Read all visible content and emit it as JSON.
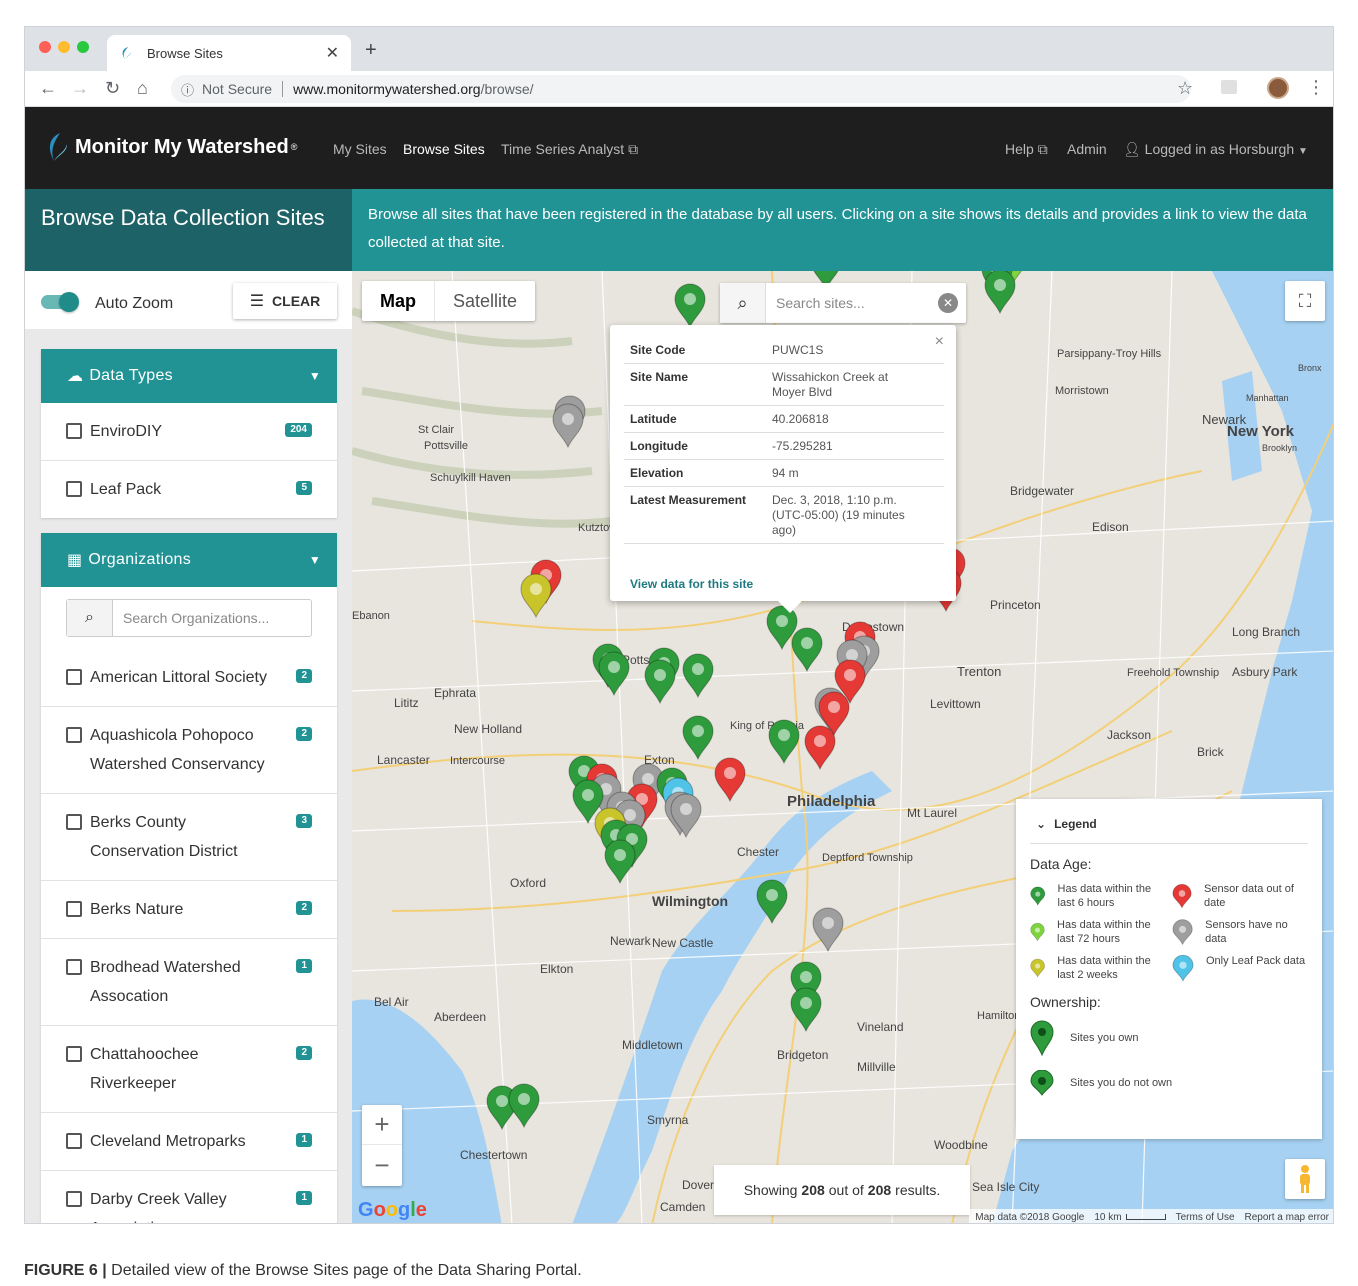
{
  "browser": {
    "tab_title": "Browse Sites",
    "security_label": "Not Secure",
    "url_host": "www.monitormywatershed.org",
    "url_path": "/browse/"
  },
  "nav": {
    "brand": "Monitor My Watershed",
    "brand_mark": "®",
    "my_sites": "My Sites",
    "browse_sites": "Browse Sites",
    "time_series": "Time Series Analyst",
    "help": "Help",
    "admin": "Admin",
    "logged_in": "Logged in as Horsburgh"
  },
  "banner": {
    "title": "Browse Data Collection Sites",
    "description": "Browse all sites that have been registered in the database by all users. Clicking on a site shows its details and provides a link to view the data collected at that site."
  },
  "sidebar": {
    "auto_zoom": "Auto Zoom",
    "clear": "CLEAR",
    "data_types_title": "Data Types",
    "data_types": [
      {
        "label": "EnviroDIY",
        "count": "204"
      },
      {
        "label": "Leaf Pack",
        "count": "5"
      }
    ],
    "organizations_title": "Organizations",
    "org_search_placeholder": "Search Organizations...",
    "organizations": [
      {
        "label": "American Littoral Society",
        "count": "2"
      },
      {
        "label": "Aquashicola Pohopoco Watershed Conservancy",
        "count": "2"
      },
      {
        "label": "Berks County Conservation District",
        "count": "3"
      },
      {
        "label": "Berks Nature",
        "count": "2"
      },
      {
        "label": "Brodhead Watershed Assocation",
        "count": "1"
      },
      {
        "label": "Chattahoochee Riverkeeper",
        "count": "2"
      },
      {
        "label": "Cleveland Metroparks",
        "count": "1"
      },
      {
        "label": "Darby Creek Valley Association",
        "count": "1"
      }
    ]
  },
  "map": {
    "type_map": "Map",
    "type_satellite": "Satellite",
    "search_placeholder": "Search sites...",
    "showing_prefix": "Showing",
    "showing_count": "208",
    "showing_mid": "out of",
    "showing_total": "208",
    "showing_suffix": "results.",
    "google": "Google",
    "attribution": "Map data ©2018 Google",
    "scale": "10 km",
    "terms": "Terms of Use",
    "report": "Report a map error",
    "place_labels": [
      "Philadelphia",
      "Wilmington",
      "Trenton",
      "Princeton",
      "Doylestown",
      "Pottstown",
      "Lancaster",
      "New York",
      "Newark",
      "Edison",
      "Chester",
      "Vineland",
      "Bridgeton",
      "Dover",
      "Levittown",
      "Exton",
      "Oxford",
      "Elkton",
      "Newark",
      "New Castle",
      "Millville",
      "Smyrna",
      "Camden",
      "Long Branch",
      "Asbury Park",
      "Freehold Township",
      "Jackson",
      "Brick",
      "Mt Laurel",
      "Deptford Township",
      "King of Prussia",
      "Ephrata",
      "Lititz",
      "New Holland",
      "Intercourse",
      "Pottsville",
      "Schuylkill Haven",
      "St Clair",
      "Morristown",
      "Parsippany-Troy Hills",
      "Bridgewater",
      "Aberdeen",
      "Bel Air",
      "Middletown",
      "Woodbine",
      "Sea Isle City",
      "Hamilton Township",
      "Chestertown",
      "Kutztown",
      "Ebanon",
      "Manhattan",
      "Brooklyn",
      "Bronx"
    ]
  },
  "infowindow": {
    "rows": [
      {
        "k": "Site Code",
        "v": "PUWC1S"
      },
      {
        "k": "Site Name",
        "v": "Wissahickon Creek at Moyer Blvd"
      },
      {
        "k": "Latitude",
        "v": "40.206818"
      },
      {
        "k": "Longitude",
        "v": "-75.295281"
      },
      {
        "k": "Elevation",
        "v": "94 m"
      },
      {
        "k": "Latest Measurement",
        "v": "Dec. 3, 2018, 1:10 p.m. (UTC-05:00) (19 minutes ago)"
      }
    ],
    "link": "View data for this site"
  },
  "legend": {
    "title": "Legend",
    "data_age_title": "Data Age:",
    "items": [
      {
        "label": "Has data within the last 6 hours",
        "color": "#2e9b3c"
      },
      {
        "label": "Sensor data out of date",
        "color": "#e53935"
      },
      {
        "label": "Has data within the last 72 hours",
        "color": "#7ed43e"
      },
      {
        "label": "Sensors have no data",
        "color": "#9e9e9e"
      },
      {
        "label": "Has data within the last 2 weeks",
        "color": "#c8c42a"
      },
      {
        "label": "Only Leaf Pack data",
        "color": "#4fc3e8"
      }
    ],
    "ownership_title": "Ownership:",
    "own": "Sites you own",
    "not_own": "Sites you do not own"
  },
  "caption": {
    "label": "FIGURE 6 |",
    "text": "Detailed view of the Browse Sites page of the Data Sharing Portal."
  }
}
